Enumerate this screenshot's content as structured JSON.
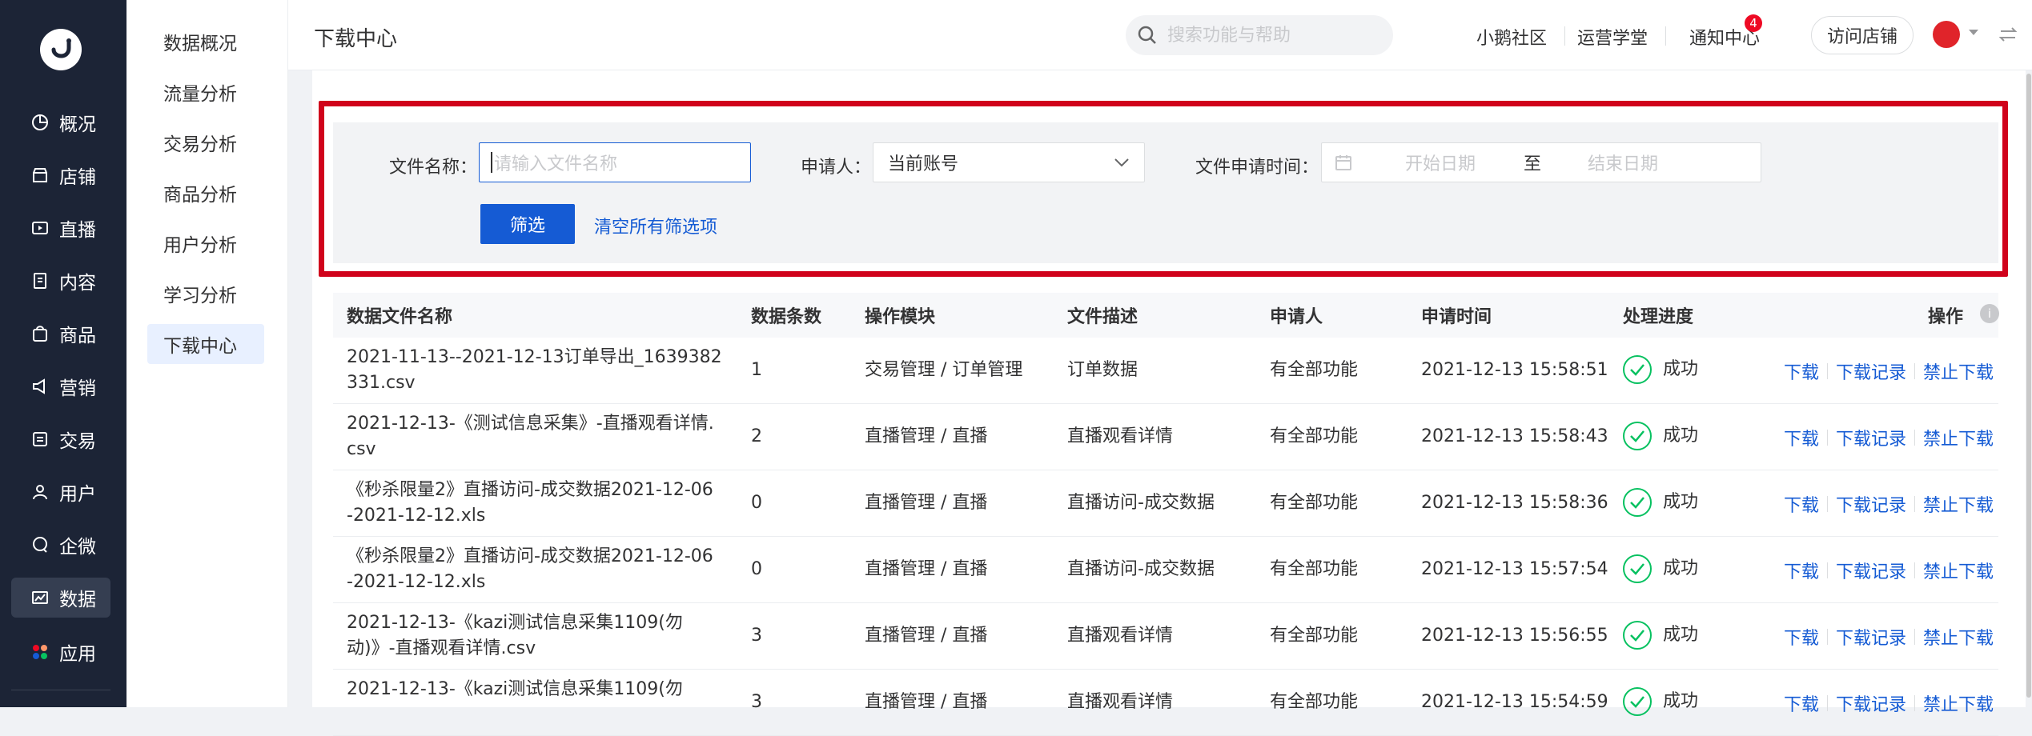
{
  "rail": {
    "items": [
      {
        "label": "概况",
        "icon": "pie-chart-icon"
      },
      {
        "label": "店铺",
        "icon": "store-icon"
      },
      {
        "label": "直播",
        "icon": "live-icon"
      },
      {
        "label": "内容",
        "icon": "document-icon"
      },
      {
        "label": "商品",
        "icon": "bag-icon"
      },
      {
        "label": "营销",
        "icon": "megaphone-icon"
      },
      {
        "label": "交易",
        "icon": "trade-icon"
      },
      {
        "label": "用户",
        "icon": "user-icon"
      },
      {
        "label": "企微",
        "icon": "chat-icon"
      },
      {
        "label": "数据",
        "icon": "data-icon"
      },
      {
        "label": "应用",
        "icon": "apps-icon"
      }
    ],
    "active": "数据"
  },
  "subnav": {
    "items": [
      "数据概况",
      "流量分析",
      "交易分析",
      "商品分析",
      "用户分析",
      "学习分析",
      "下载中心"
    ],
    "active": "下载中心"
  },
  "header": {
    "title": "下载中心",
    "search_placeholder": "搜索功能与帮助",
    "links": [
      "小鹅社区",
      "运营学堂",
      "通知中心"
    ],
    "notification_count": "4",
    "visit_store": "访问店铺"
  },
  "filters": {
    "file_name_label": "文件名称：",
    "file_name_placeholder": "请输入文件名称",
    "applicant_label": "申请人：",
    "applicant_value": "当前账号",
    "time_label": "文件申请时间：",
    "start_placeholder": "开始日期",
    "range_sep": "至",
    "end_placeholder": "结束日期",
    "filter_button": "筛选",
    "clear_link": "清空所有筛选项"
  },
  "table": {
    "columns": [
      "数据文件名称",
      "数据条数",
      "操作模块",
      "文件描述",
      "申请人",
      "申请时间",
      "处理进度",
      "操作"
    ],
    "rows": [
      {
        "name1": "2021-11-13--2021-12-13订单导出_1639382",
        "name2": "331.csv",
        "count": "1",
        "module": "交易管理 / 订单管理",
        "desc": "订单数据",
        "applicant": "有全部功能",
        "time": "2021-12-13 15:58:51",
        "status": "成功"
      },
      {
        "name1": "2021-12-13-《测试信息采集》-直播观看详情.",
        "name2": "csv",
        "count": "2",
        "module": "直播管理 / 直播",
        "desc": "直播观看详情",
        "applicant": "有全部功能",
        "time": "2021-12-13 15:58:43",
        "status": "成功"
      },
      {
        "name1": "《秒杀限量2》直播访问-成交数据2021-12-06",
        "name2": "-2021-12-12.xls",
        "count": "0",
        "module": "直播管理 / 直播",
        "desc": "直播访问-成交数据",
        "applicant": "有全部功能",
        "time": "2021-12-13 15:58:36",
        "status": "成功"
      },
      {
        "name1": "《秒杀限量2》直播访问-成交数据2021-12-06",
        "name2": "-2021-12-12.xls",
        "count": "0",
        "module": "直播管理 / 直播",
        "desc": "直播访问-成交数据",
        "applicant": "有全部功能",
        "time": "2021-12-13 15:57:54",
        "status": "成功"
      },
      {
        "name1": "2021-12-13-《kazi测试信息采集1109(勿",
        "name2": "动)》-直播观看详情.csv",
        "count": "3",
        "module": "直播管理 / 直播",
        "desc": "直播观看详情",
        "applicant": "有全部功能",
        "time": "2021-12-13 15:56:55",
        "status": "成功"
      },
      {
        "name1": "2021-12-13-《kazi测试信息采集1109(勿",
        "name2": "",
        "count": "3",
        "module": "直播管理 / 直播",
        "desc": "直播观看详情",
        "applicant": "有全部功能",
        "time": "2021-12-13 15:54:59",
        "status": "成功"
      }
    ],
    "actions": [
      "下载",
      "下载记录",
      "禁止下载"
    ]
  },
  "colors": {
    "primary": "#155bd4",
    "rail_bg": "#1c2436",
    "success": "#07c160",
    "highlight_frame": "#d0021b"
  }
}
